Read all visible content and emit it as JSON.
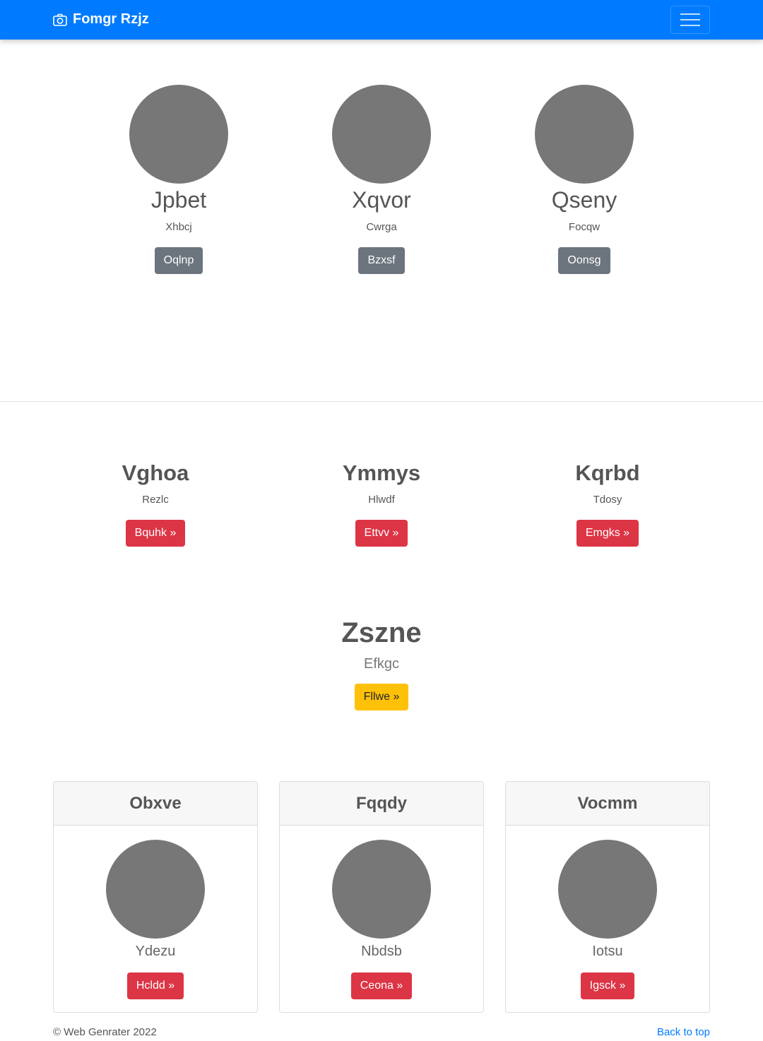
{
  "navbar": {
    "brand": "Fomgr Rzjz",
    "brand_icon": "camera-icon",
    "toggler_icon": "hamburger-menu-icon",
    "color": "#007bff"
  },
  "team": [
    {
      "name": "Jpbet",
      "subtitle": "Xhbcj",
      "button": "Oqlnp"
    },
    {
      "name": "Xqvor",
      "subtitle": "Cwrga",
      "button": "Bzxsf"
    },
    {
      "name": "Qseny",
      "subtitle": "Focqw",
      "button": "Oonsg"
    }
  ],
  "features": [
    {
      "title": "Vghoa",
      "subtitle": "Rezlc",
      "button": "Bquhk »"
    },
    {
      "title": "Ymmys",
      "subtitle": "Hlwdf",
      "button": "Ettvv »"
    },
    {
      "title": "Kqrbd",
      "subtitle": "Tdosy",
      "button": "Emgks »"
    }
  ],
  "hero": {
    "title": "Zszne",
    "subtitle": "Efkgc",
    "button": "Fllwe »"
  },
  "cards": [
    {
      "header": "Obxve",
      "name": "Ydezu",
      "button": "Hcldd »"
    },
    {
      "header": "Fqqdy",
      "name": "Nbdsb",
      "button": "Ceona »"
    },
    {
      "header": "Vocmm",
      "name": "Iotsu",
      "button": "Igsck »"
    }
  ],
  "footer": {
    "copyright": "© Web Genrater 2022",
    "back_to_top": "Back to top"
  },
  "colors": {
    "secondary": "#6c757d",
    "danger": "#dc3545",
    "warning": "#ffc107",
    "avatar": "#777777"
  }
}
